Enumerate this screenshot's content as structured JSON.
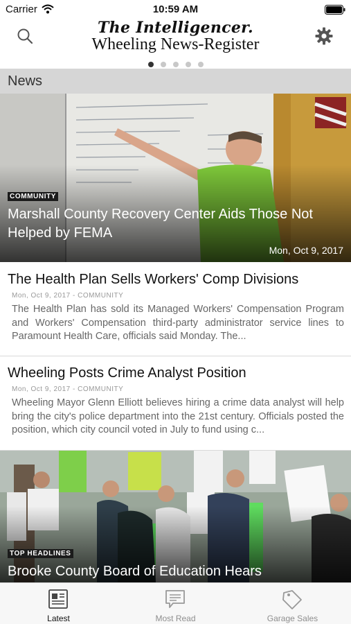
{
  "status_bar": {
    "carrier": "Carrier",
    "time": "10:59 AM"
  },
  "header": {
    "masthead_line1": "The Intelligencer.",
    "masthead_line2": "Wheeling News-Register",
    "icons": {
      "left": "search-icon",
      "right": "gear-icon"
    },
    "page_count": 5,
    "active_page": 1
  },
  "section": {
    "title": "News"
  },
  "feed": {
    "hero1": {
      "category": "COMMUNITY",
      "title": "Marshall County Recovery Center Aids Those Not Helped by FEMA",
      "date": "Mon, Oct 9, 2017"
    },
    "article1": {
      "title": "The Health Plan Sells Workers' Comp Divisions",
      "meta": "Mon, Oct 9, 2017 - COMMUNITY",
      "summary": "The Health Plan has sold its Managed Workers' Compensation Program and Workers' Compensation third-party administrator service lines to Paramount Health Care, officials said Monday. The..."
    },
    "article2": {
      "title": "Wheeling Posts Crime Analyst Position",
      "meta": "Mon, Oct 9, 2017 - COMMUNITY",
      "summary": "Wheeling Mayor Glenn Elliott believes hiring a crime data analyst will help bring the city's police department into the 21st century. Officials posted the position, which city council voted in July to fund using c..."
    },
    "hero2": {
      "category": "TOP HEADLINES",
      "title": "Brooke County Board of Education Hears"
    }
  },
  "tab_bar": {
    "tabs": [
      {
        "label": "Latest",
        "icon": "newspaper-icon",
        "active": true
      },
      {
        "label": "Most Read",
        "icon": "chat-bubble-icon",
        "active": false
      },
      {
        "label": "Garage Sales",
        "icon": "price-tag-icon",
        "active": false
      }
    ]
  },
  "colors": {
    "section_bg": "#d6d6d6",
    "badge_bg": "#1b1b1b",
    "tab_active": "#111111",
    "tab_inactive": "#8e8e8e"
  }
}
